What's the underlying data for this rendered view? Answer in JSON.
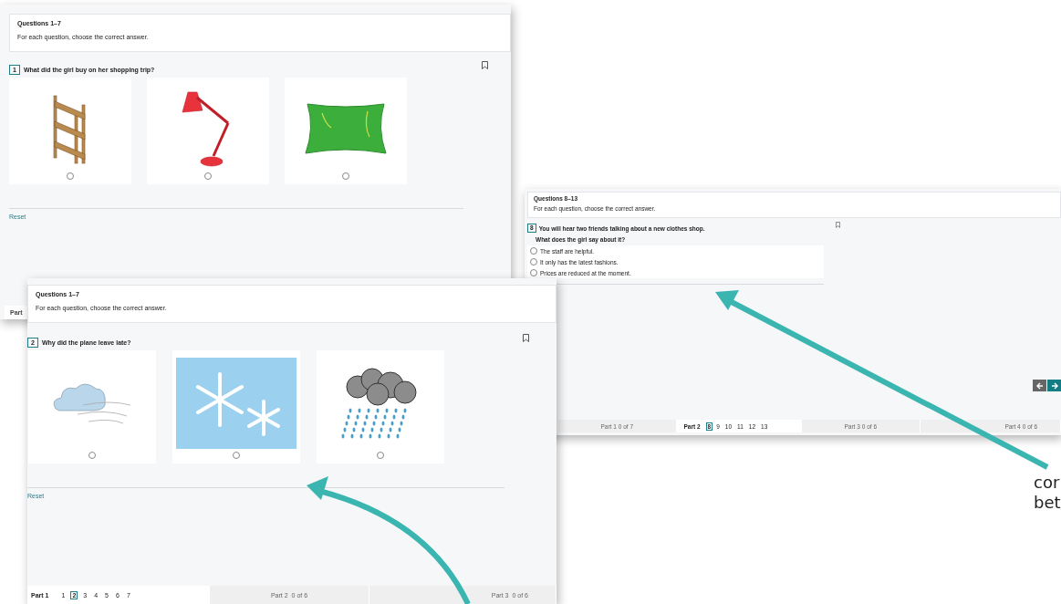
{
  "back_window": {
    "title": "Questions 1–7",
    "instruction": "For each question, choose the correct answer.",
    "question_number": "1",
    "question": "What did the girl buy on her shopping trip?",
    "options": [
      {
        "kind": "shelf",
        "selected": false
      },
      {
        "kind": "lamp",
        "selected": false
      },
      {
        "kind": "cushion",
        "selected": false
      }
    ],
    "reset": "Reset",
    "footer_label": "Part"
  },
  "right_window": {
    "title": "Questions 8–13",
    "instruction": "For each question, choose the correct answer.",
    "question_number": "8",
    "question": "You will hear two friends talking about a new clothes shop.",
    "subquestion": "What does the girl say about it?",
    "options": [
      {
        "text": "The staff are helpful.",
        "selected": false
      },
      {
        "text": "It only has the latest fashions.",
        "selected": false
      },
      {
        "text": "Prices are reduced at the moment.",
        "selected": false
      }
    ],
    "parts": [
      {
        "label": "Part 1",
        "progress": "0 of 7",
        "selected": false
      },
      {
        "label": "Part 2",
        "selected": true,
        "questions": [
          {
            "number": "8",
            "selected": true
          },
          {
            "number": "9",
            "selected": false
          },
          {
            "number": "10",
            "selected": false
          },
          {
            "number": "11",
            "selected": false
          },
          {
            "number": "12",
            "selected": false
          },
          {
            "number": "13",
            "selected": false
          }
        ]
      },
      {
        "label": "Part 3",
        "progress": "0 of 6",
        "selected": false
      },
      {
        "label": "Part 4",
        "progress": "0 of 6",
        "selected": false
      }
    ]
  },
  "front_window": {
    "title": "Questions 1–7",
    "instruction": "For each question, choose the correct answer.",
    "question_number": "2",
    "question": "Why did the plane leave late?",
    "options": [
      {
        "kind": "windy-cloud",
        "selected": false
      },
      {
        "kind": "snowflakes",
        "selected": false
      },
      {
        "kind": "rain-cloud",
        "selected": false
      }
    ],
    "reset": "Reset",
    "parts": [
      {
        "label": "Part 1",
        "selected": true,
        "questions": [
          {
            "number": "1",
            "selected": false
          },
          {
            "number": "2",
            "selected": true
          },
          {
            "number": "3",
            "selected": false
          },
          {
            "number": "4",
            "selected": false
          },
          {
            "number": "5",
            "selected": false
          },
          {
            "number": "6",
            "selected": false
          },
          {
            "number": "7",
            "selected": false
          }
        ]
      },
      {
        "label": "Part 2",
        "progress": "0 of 6",
        "selected": false
      },
      {
        "label": "Part 3",
        "progress": "0 of 6",
        "selected": false
      }
    ]
  },
  "caption_lines": [
    "cor",
    "bet"
  ]
}
